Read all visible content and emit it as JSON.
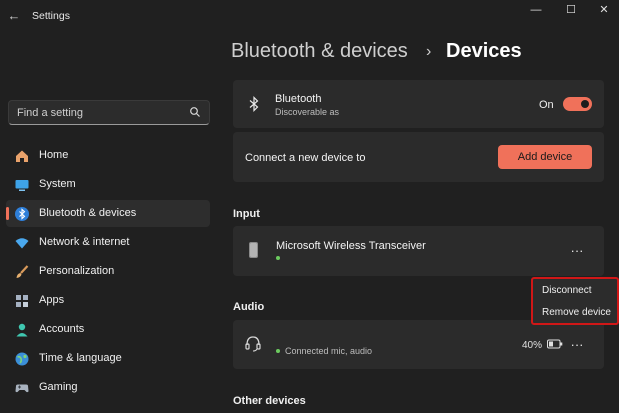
{
  "window": {
    "title": "Settings",
    "back_glyph": "←",
    "minimize_glyph": "—",
    "maximize_glyph": "☐",
    "close_glyph": "✕"
  },
  "search": {
    "placeholder": "Find a setting"
  },
  "sidebar": {
    "items": [
      {
        "label": "Home",
        "icon": "home-icon",
        "selected": false
      },
      {
        "label": "System",
        "icon": "system-icon",
        "selected": false
      },
      {
        "label": "Bluetooth & devices",
        "icon": "bluetooth-icon",
        "selected": true
      },
      {
        "label": "Network & internet",
        "icon": "network-icon",
        "selected": false
      },
      {
        "label": "Personalization",
        "icon": "brush-icon",
        "selected": false
      },
      {
        "label": "Apps",
        "icon": "apps-icon",
        "selected": false
      },
      {
        "label": "Accounts",
        "icon": "accounts-icon",
        "selected": false
      },
      {
        "label": "Time & language",
        "icon": "globe-icon",
        "selected": false
      },
      {
        "label": "Gaming",
        "icon": "gaming-icon",
        "selected": false
      }
    ]
  },
  "breadcrumb": {
    "parent": "Bluetooth & devices",
    "separator": "›",
    "current": "Devices"
  },
  "bluetooth": {
    "title": "Bluetooth",
    "subtitle": "Discoverable as",
    "state_label": "On",
    "enabled": true
  },
  "connect": {
    "label": "Connect a new device to",
    "button": "Add device"
  },
  "sections": {
    "input": "Input",
    "audio": "Audio",
    "other": "Other devices"
  },
  "input_device": {
    "name": "Microsoft Wireless Transceiver",
    "more": "···"
  },
  "audio_device": {
    "status": "Connected mic, audio",
    "battery": "40%",
    "more": "···"
  },
  "context_menu": {
    "items": [
      "Disconnect",
      "Remove device"
    ]
  },
  "colors": {
    "accent": "#f0715a",
    "background": "#202020",
    "card": "#2b2b2b",
    "status_green": "#6ccb5f",
    "highlight_border": "#d01717"
  }
}
